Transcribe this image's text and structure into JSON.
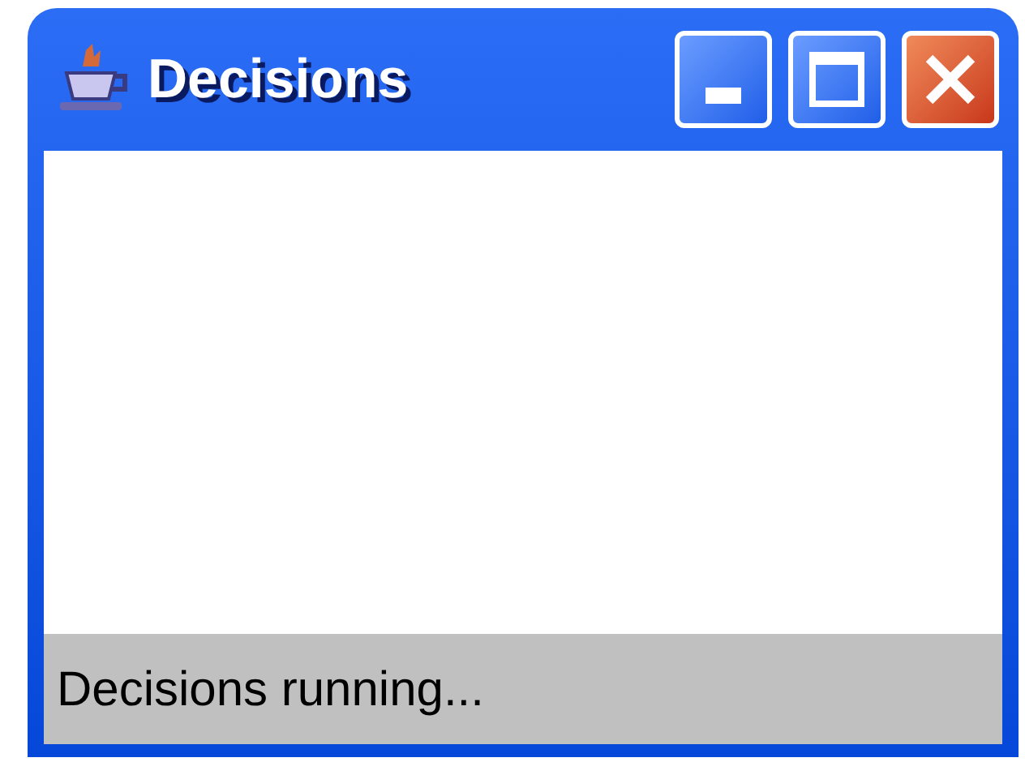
{
  "window": {
    "title": "Decisions"
  },
  "status_bar": {
    "text": "Decisions running..."
  }
}
